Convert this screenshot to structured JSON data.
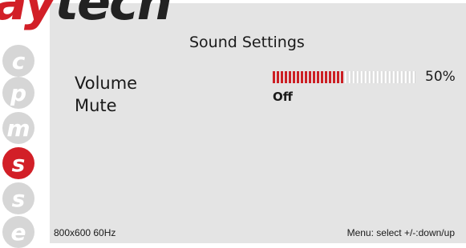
{
  "brand": {
    "part1": "ay",
    "part2": "tech"
  },
  "nav": [
    {
      "letter": "c",
      "icon": "c-letter-icon",
      "active": false
    },
    {
      "letter": "p",
      "icon": "p-letter-icon",
      "active": false
    },
    {
      "letter": "m",
      "icon": "m-letter-icon",
      "active": false
    },
    {
      "letter": "s",
      "icon": "s-letter-icon",
      "active": true
    },
    {
      "letter": "s",
      "icon": "s-letter-icon",
      "active": false
    },
    {
      "letter": "e",
      "icon": "e-letter-icon",
      "active": false
    }
  ],
  "title": "Sound Settings",
  "settings": {
    "volume": {
      "label": "Volume",
      "percent_text": "50%",
      "level": 0.5
    },
    "mute": {
      "label": "Mute",
      "value": "Off"
    }
  },
  "footer": {
    "resolution": "800x600 60Hz",
    "hint": "Menu: select +/-:down/up"
  },
  "colors": {
    "accent": "#d21f27",
    "panel": "#e4e4e4",
    "inactive_nav": "#d6d6d6"
  }
}
